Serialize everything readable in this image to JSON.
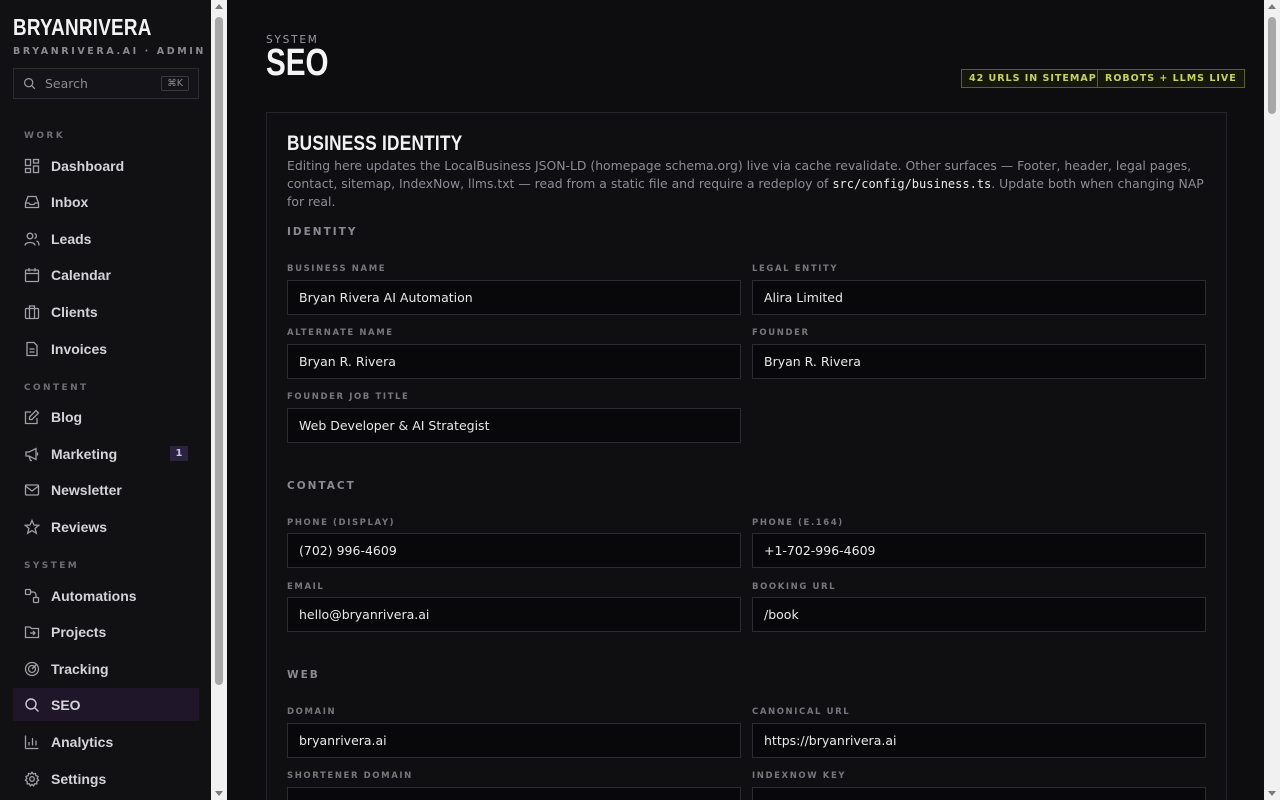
{
  "sidebar": {
    "brand": "BRYANRIVERA",
    "brand_sub": "BRYANRIVERA.AI · ADMIN",
    "search_placeholder": "Search",
    "search_shortcut": "⌘K",
    "sections": {
      "work": "WORK",
      "content": "CONTENT",
      "system": "SYSTEM"
    },
    "items": [
      {
        "label": "Dashboard",
        "icon": "dashboard-icon"
      },
      {
        "label": "Inbox",
        "icon": "inbox-icon"
      },
      {
        "label": "Leads",
        "icon": "users-icon"
      },
      {
        "label": "Calendar",
        "icon": "calendar-icon"
      },
      {
        "label": "Clients",
        "icon": "briefcase-icon"
      },
      {
        "label": "Invoices",
        "icon": "document-icon"
      },
      {
        "label": "Blog",
        "icon": "edit-icon"
      },
      {
        "label": "Marketing",
        "icon": "megaphone-icon",
        "badge": "1"
      },
      {
        "label": "Newsletter",
        "icon": "mail-icon"
      },
      {
        "label": "Reviews",
        "icon": "star-icon"
      },
      {
        "label": "Automations",
        "icon": "workflow-icon"
      },
      {
        "label": "Projects",
        "icon": "folder-icon"
      },
      {
        "label": "Tracking",
        "icon": "radar-icon"
      },
      {
        "label": "SEO",
        "icon": "search-icon",
        "active": true
      },
      {
        "label": "Analytics",
        "icon": "bar-chart-icon"
      },
      {
        "label": "Settings",
        "icon": "gear-icon"
      }
    ]
  },
  "header": {
    "eyebrow": "SYSTEM",
    "title": "SEO",
    "pills": [
      "42 URLS IN SITEMAP",
      "ROBOTS + LLMS LIVE"
    ]
  },
  "card": {
    "title": "BUSINESS IDENTITY",
    "desc_before": "Editing here updates the LocalBusiness JSON-LD (homepage schema.org) live via cache revalidate. Other surfaces — Footer, header, legal pages, contact, sitemap, IndexNow, llms.txt — read from a static file and require a redeploy of ",
    "desc_code": "src/config/business.ts",
    "desc_after": ". Update both when changing NAP for real.",
    "groups": {
      "identity": "IDENTITY",
      "contact": "CONTACT",
      "web": "WEB"
    },
    "fields": {
      "business_name": {
        "label": "BUSINESS NAME",
        "value": "Bryan Rivera AI Automation"
      },
      "legal_entity": {
        "label": "LEGAL ENTITY",
        "value": "Alira Limited"
      },
      "alternate_name": {
        "label": "ALTERNATE NAME",
        "value": "Bryan R. Rivera"
      },
      "founder": {
        "label": "FOUNDER",
        "value": "Bryan R. Rivera"
      },
      "founder_job_title": {
        "label": "FOUNDER JOB TITLE",
        "value": "Web Developer & AI Strategist"
      },
      "phone_display": {
        "label": "PHONE (DISPLAY)",
        "value": "(702) 996-4609"
      },
      "phone_e164": {
        "label": "PHONE (E.164)",
        "value": "+1-702-996-4609"
      },
      "email": {
        "label": "EMAIL",
        "value": "hello@bryanrivera.ai"
      },
      "booking_url": {
        "label": "BOOKING URL",
        "value": "/book"
      },
      "domain": {
        "label": "DOMAIN",
        "value": "bryanrivera.ai"
      },
      "canonical_url": {
        "label": "CANONICAL URL",
        "value": "https://bryanrivera.ai"
      },
      "shortener_domain": {
        "label": "SHORTENER DOMAIN",
        "value": ""
      },
      "indexnow_key": {
        "label": "INDEXNOW KEY",
        "value": ""
      }
    }
  },
  "colors": {
    "accent_active": "#1f1729",
    "pill_text": "#c8d35a",
    "pill_border": "#5a6128"
  }
}
